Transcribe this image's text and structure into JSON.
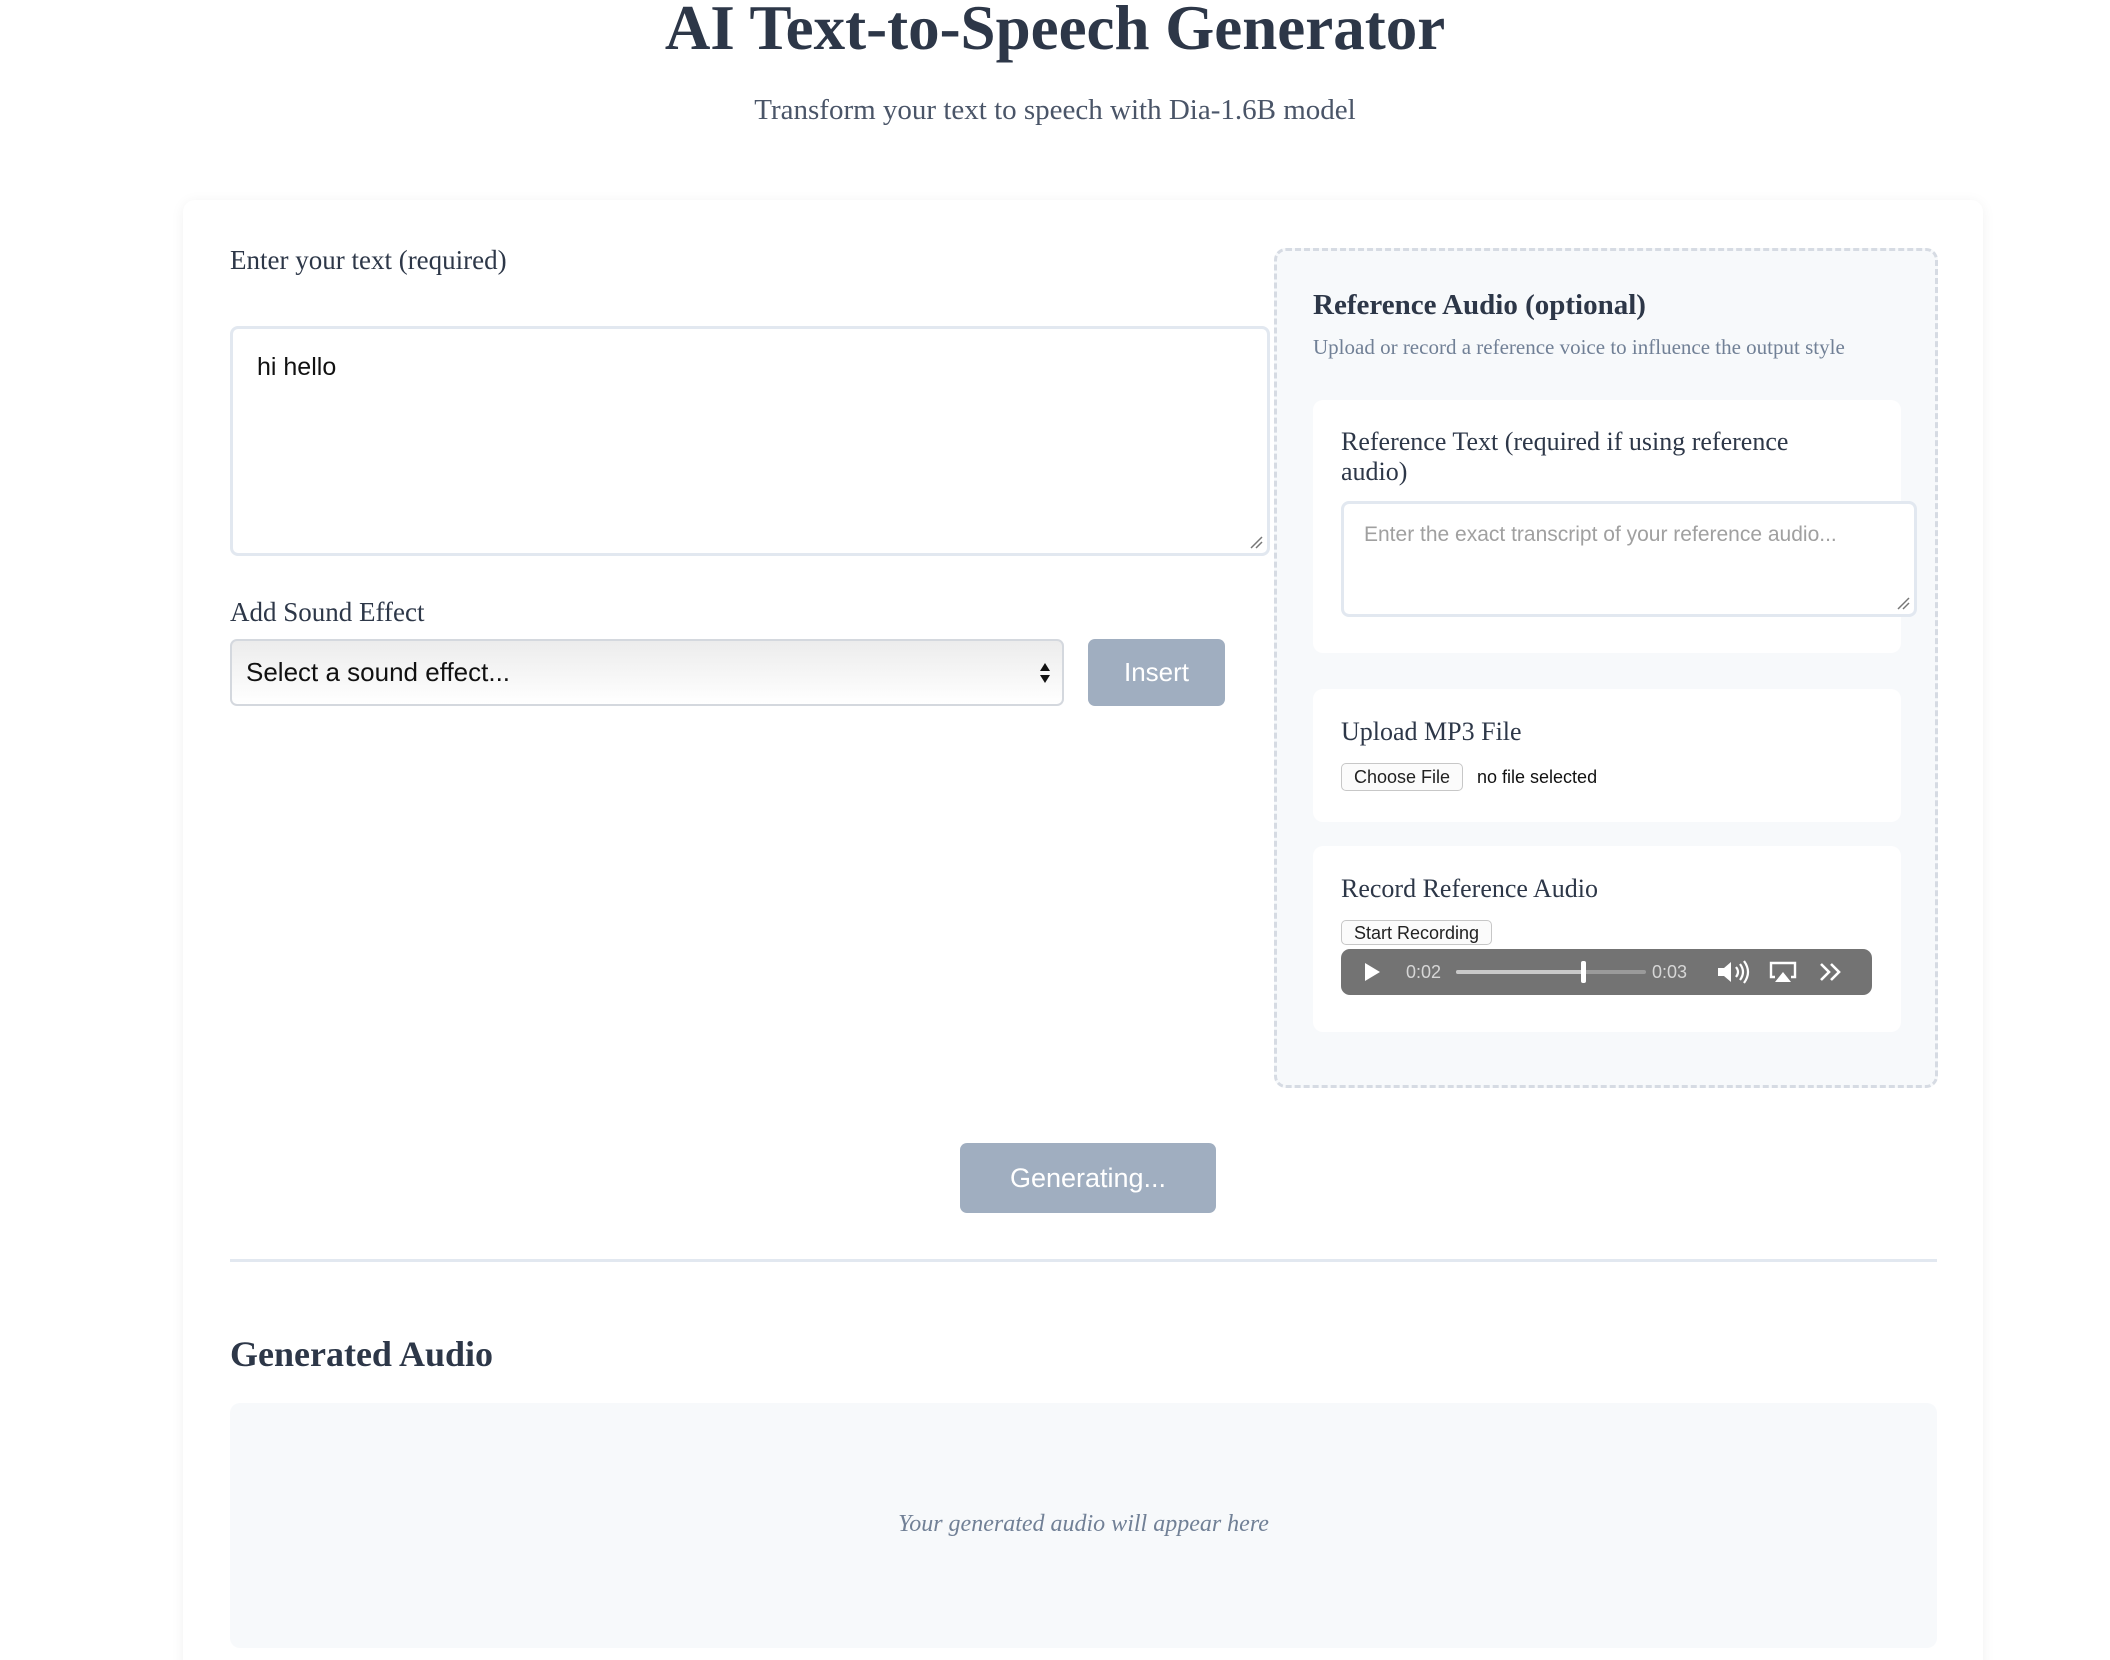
{
  "header": {
    "title": "AI Text-to-Speech Generator",
    "subtitle": "Transform your text to speech with Dia-1.6B model"
  },
  "main": {
    "text_label": "Enter your text (required)",
    "text_value": "hi hello",
    "sound_effect_label": "Add Sound Effect",
    "sound_effect_selected": "Select a sound effect...",
    "insert_label": "Insert",
    "generate_label": "Generating..."
  },
  "reference": {
    "title": "Reference Audio (optional)",
    "description": "Upload or record a reference voice to influence the output style",
    "text_label": "Reference Text (required if using reference audio)",
    "text_placeholder": "Enter the exact transcript of your reference audio...",
    "upload_label": "Upload MP3 File",
    "choose_file_label": "Choose File",
    "file_status": "no file selected",
    "record_label": "Record Reference Audio",
    "start_recording_label": "Start Recording",
    "player": {
      "current_time": "0:02",
      "duration": "0:03",
      "progress": 0.67
    }
  },
  "output": {
    "title": "Generated Audio",
    "placeholder": "Your generated audio will appear here"
  },
  "colors": {
    "heading": "#2d3748",
    "muted": "#718096",
    "disabled_button": "#a0aec0",
    "panel_bg": "#f7f9fb",
    "border": "#e2e8f0"
  }
}
